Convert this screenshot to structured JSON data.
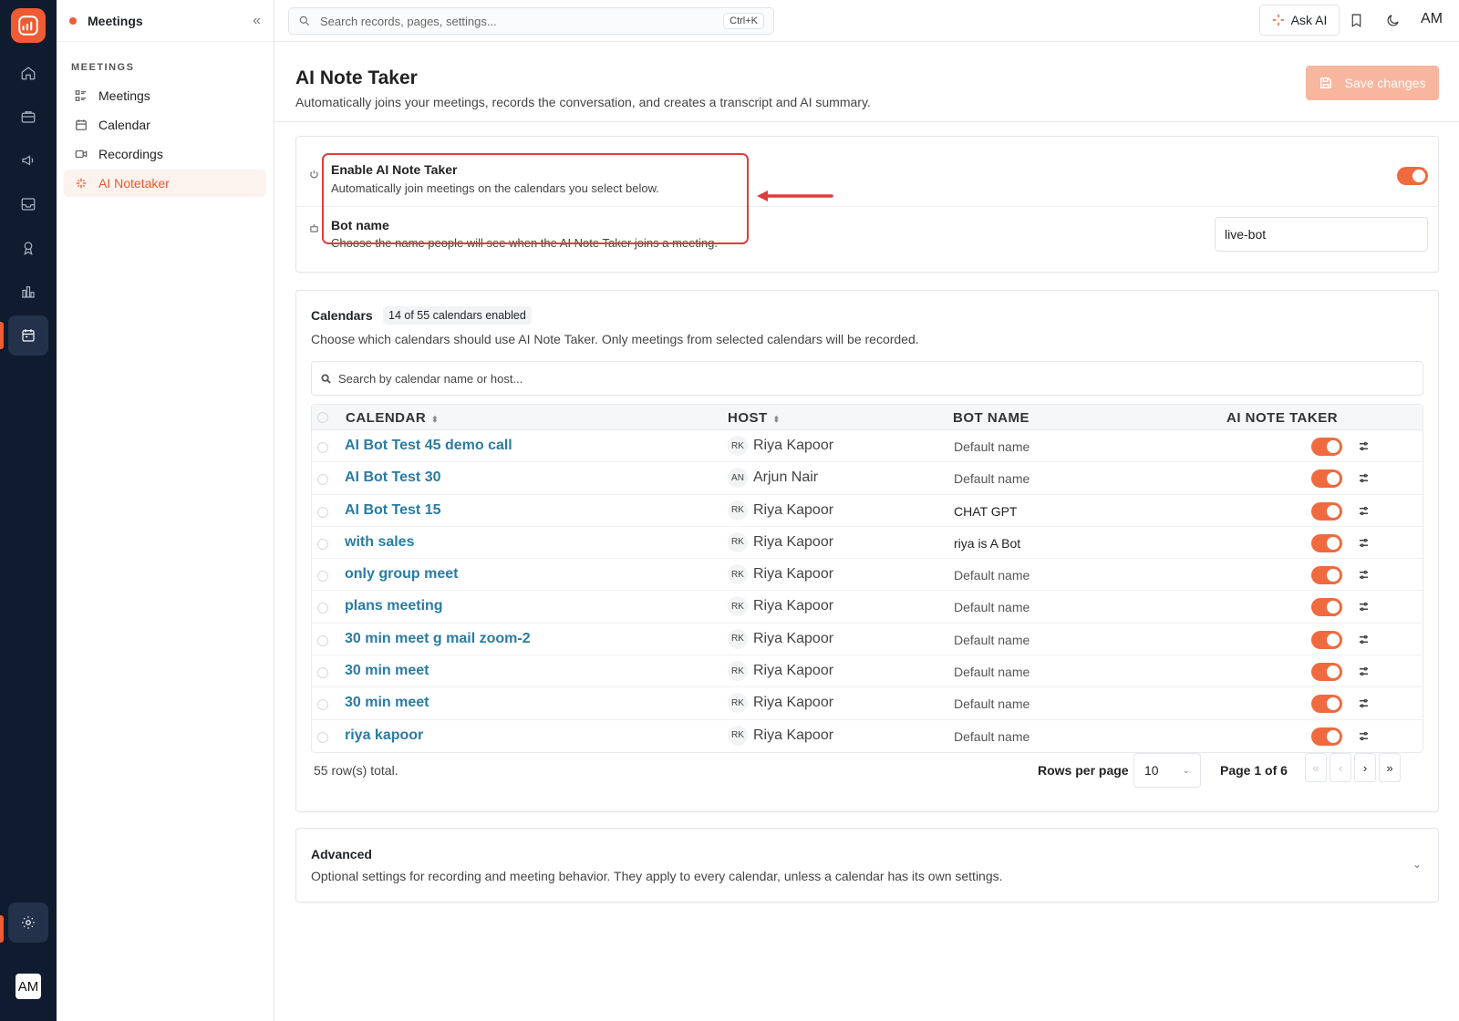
{
  "sidebar": {
    "title": "Meetings",
    "collapse_icon": "double-chevron-left",
    "section": "MEETINGS",
    "items": [
      {
        "label": "Meetings",
        "icon": "list-icon"
      },
      {
        "label": "Calendar",
        "icon": "calendar-icon"
      },
      {
        "label": "Recordings",
        "icon": "video-icon"
      },
      {
        "label": "AI Notetaker",
        "icon": "sparkle-icon"
      }
    ]
  },
  "topbar": {
    "search_placeholder": "Search records, pages, settings...",
    "shortcut": "Ctrl+K",
    "ask_ai": "Ask AI",
    "avatar": "AM"
  },
  "rail": {
    "avatar": "AM"
  },
  "header": {
    "title": "AI Note Taker",
    "subtitle": "Automatically joins your meetings, records the conversation, and creates a transcript and AI summary.",
    "save_label": "Save changes"
  },
  "settings": {
    "enable_label": "Enable AI Note Taker",
    "enable_desc": "Automatically join meetings on the calendars you select below.",
    "enable_on": true,
    "bot_label": "Bot name",
    "bot_desc": "Choose the name people will see when the AI Note Taker joins a meeting.",
    "bot_value": "live-bot"
  },
  "calendars": {
    "title": "Calendars",
    "badge": "14 of 55 calendars enabled",
    "desc": "Choose which calendars should use AI Note Taker. Only meetings from selected calendars will be recorded.",
    "search_placeholder": "Search by calendar name or host...",
    "columns": {
      "calendar": "CALENDAR",
      "host": "HOST",
      "bot": "BOT NAME",
      "ai": "AI NOTE TAKER"
    },
    "rows": [
      {
        "name": "AI Bot Test 45 demo call",
        "ini": "RK",
        "host": "Riya Kapoor",
        "bot": "Default name",
        "on": true
      },
      {
        "name": "AI Bot Test 30",
        "ini": "AN",
        "host": "Arjun Nair",
        "bot": "Default name",
        "on": true
      },
      {
        "name": "AI Bot Test 15",
        "ini": "RK",
        "host": "Riya Kapoor",
        "bot": "CHAT GPT",
        "on": true
      },
      {
        "name": "with sales",
        "ini": "RK",
        "host": "Riya Kapoor",
        "bot": "riya is A Bot",
        "on": true
      },
      {
        "name": "only group meet",
        "ini": "RK",
        "host": "Riya Kapoor",
        "bot": "Default name",
        "on": true
      },
      {
        "name": "plans meeting",
        "ini": "RK",
        "host": "Riya Kapoor",
        "bot": "Default name",
        "on": true
      },
      {
        "name": "30 min meet g mail zoom-2",
        "ini": "RK",
        "host": "Riya Kapoor",
        "bot": "Default name",
        "on": true
      },
      {
        "name": "30 min meet",
        "ini": "RK",
        "host": "Riya Kapoor",
        "bot": "Default name",
        "on": true
      },
      {
        "name": "30 min meet",
        "ini": "RK",
        "host": "Riya Kapoor",
        "bot": "Default name",
        "on": true
      },
      {
        "name": "riya kapoor",
        "ini": "RK",
        "host": "Riya Kapoor",
        "bot": "Default name",
        "on": true
      }
    ],
    "total": "55 row(s) total.",
    "rows_per_page_label": "Rows per page",
    "rows_per_page": "10",
    "page_label": "Page 1 of 6",
    "pager": {
      "first": "«",
      "prev": "‹",
      "next": "›",
      "last": "»"
    }
  },
  "advanced": {
    "title": "Advanced",
    "desc": "Optional settings for recording and meeting behavior. They apply to every calendar, unless a calendar has its own settings."
  },
  "colors": {
    "accent": "#ef5b32",
    "link": "#2a7ba3",
    "highlight": "#e03c3c",
    "rail": "#0f1b2e"
  }
}
